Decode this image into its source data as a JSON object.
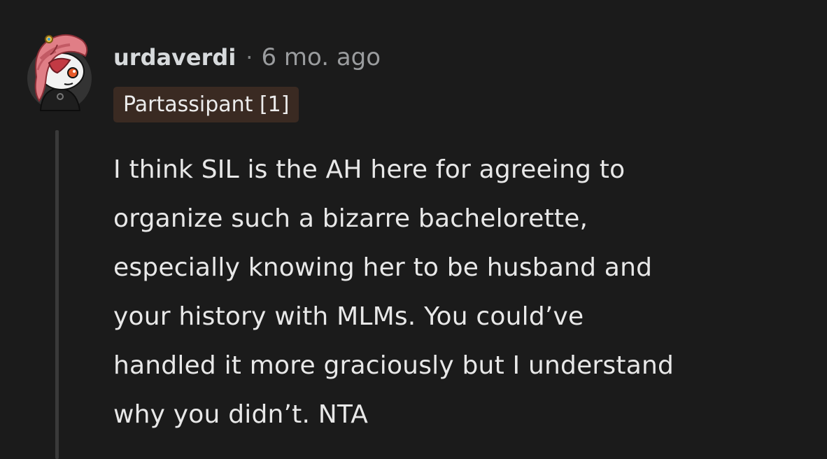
{
  "comment": {
    "username": "urdaverdi",
    "separator": "·",
    "timestamp": "6 mo. ago",
    "flair": "Partassipant [1]",
    "body_lines": [
      "I think SIL is the AH here for agreeing to",
      "organize such a bizarre bachelorette,",
      "especially knowing her to be husband and",
      "your history with MLMs. You could’ve",
      "handled it more graciously but I understand",
      "why you didn’t. NTA"
    ]
  },
  "colors": {
    "background": "#1b1b1b",
    "flair_background": "#3a2a22",
    "thread_line": "#3a3a3a"
  },
  "icons": {
    "avatar": "snoo-avatar-icon"
  }
}
